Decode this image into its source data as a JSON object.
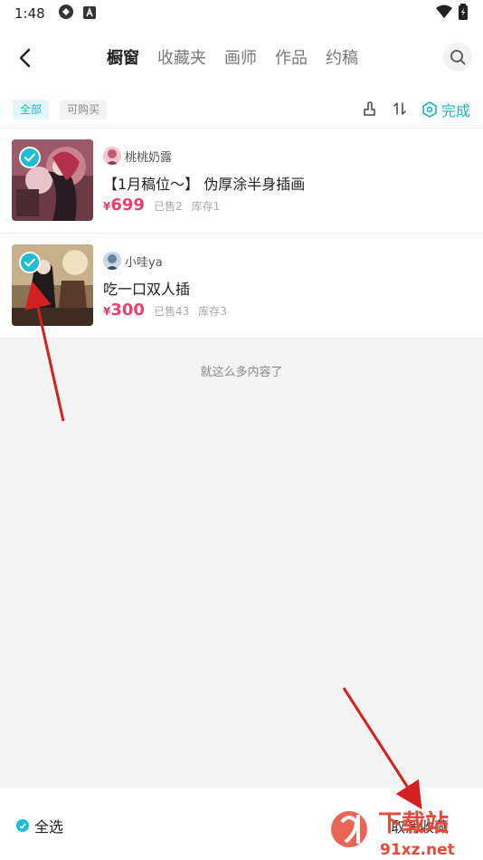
{
  "status_bar": {
    "time": "1:48"
  },
  "header": {
    "tabs": [
      {
        "label": "橱窗",
        "active": true
      },
      {
        "label": "收藏夹",
        "active": false
      },
      {
        "label": "画师",
        "active": false
      },
      {
        "label": "作品",
        "active": false
      },
      {
        "label": "约稿",
        "active": false
      }
    ]
  },
  "filters": {
    "all_label": "全部",
    "buyable_label": "可购买",
    "done_label": "完成"
  },
  "items": [
    {
      "author": "桃桃奶露",
      "title": "【1月稿位～】 伪厚涂半身插画",
      "price_symbol": "¥",
      "price": "699",
      "sold": "已售2",
      "stock": "库存1",
      "checked": true
    },
    {
      "author": "小哇ya",
      "title": "吃一口双人插",
      "price_symbol": "¥",
      "price": "300",
      "sold": "已售43",
      "stock": "库存3",
      "checked": true
    }
  ],
  "end_text": "就这么多内容了",
  "bottom": {
    "select_all": "全选",
    "cancel_favorite": "取消收藏"
  },
  "watermark": {
    "brand": "下载站",
    "url": "91xz.net"
  },
  "colors": {
    "accent": "#19b4c9",
    "price": "#e8416b",
    "arrow": "#d42020"
  }
}
